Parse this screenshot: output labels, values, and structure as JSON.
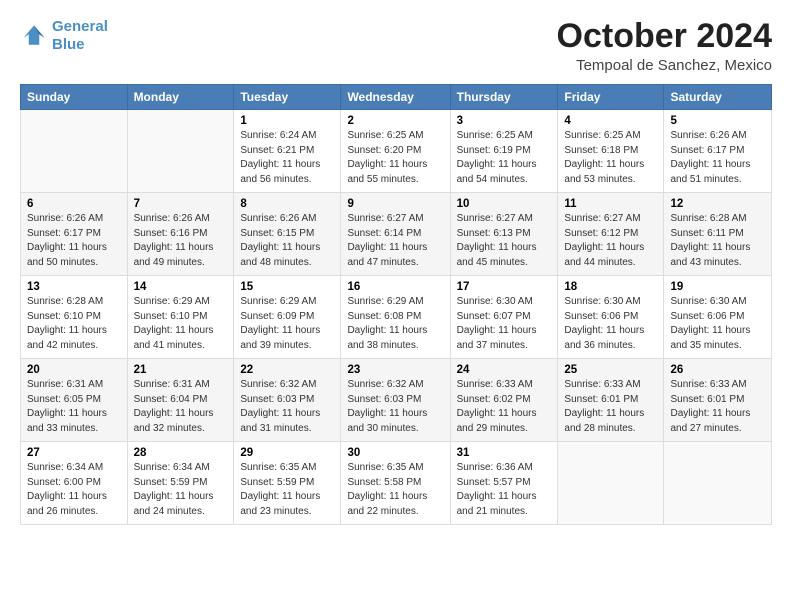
{
  "logo": {
    "line1": "General",
    "line2": "Blue"
  },
  "title": "October 2024",
  "subtitle": "Tempoal de Sanchez, Mexico",
  "headers": [
    "Sunday",
    "Monday",
    "Tuesday",
    "Wednesday",
    "Thursday",
    "Friday",
    "Saturday"
  ],
  "weeks": [
    [
      {
        "num": "",
        "detail": ""
      },
      {
        "num": "",
        "detail": ""
      },
      {
        "num": "1",
        "detail": "Sunrise: 6:24 AM\nSunset: 6:21 PM\nDaylight: 11 hours\nand 56 minutes."
      },
      {
        "num": "2",
        "detail": "Sunrise: 6:25 AM\nSunset: 6:20 PM\nDaylight: 11 hours\nand 55 minutes."
      },
      {
        "num": "3",
        "detail": "Sunrise: 6:25 AM\nSunset: 6:19 PM\nDaylight: 11 hours\nand 54 minutes."
      },
      {
        "num": "4",
        "detail": "Sunrise: 6:25 AM\nSunset: 6:18 PM\nDaylight: 11 hours\nand 53 minutes."
      },
      {
        "num": "5",
        "detail": "Sunrise: 6:26 AM\nSunset: 6:17 PM\nDaylight: 11 hours\nand 51 minutes."
      }
    ],
    [
      {
        "num": "6",
        "detail": "Sunrise: 6:26 AM\nSunset: 6:17 PM\nDaylight: 11 hours\nand 50 minutes."
      },
      {
        "num": "7",
        "detail": "Sunrise: 6:26 AM\nSunset: 6:16 PM\nDaylight: 11 hours\nand 49 minutes."
      },
      {
        "num": "8",
        "detail": "Sunrise: 6:26 AM\nSunset: 6:15 PM\nDaylight: 11 hours\nand 48 minutes."
      },
      {
        "num": "9",
        "detail": "Sunrise: 6:27 AM\nSunset: 6:14 PM\nDaylight: 11 hours\nand 47 minutes."
      },
      {
        "num": "10",
        "detail": "Sunrise: 6:27 AM\nSunset: 6:13 PM\nDaylight: 11 hours\nand 45 minutes."
      },
      {
        "num": "11",
        "detail": "Sunrise: 6:27 AM\nSunset: 6:12 PM\nDaylight: 11 hours\nand 44 minutes."
      },
      {
        "num": "12",
        "detail": "Sunrise: 6:28 AM\nSunset: 6:11 PM\nDaylight: 11 hours\nand 43 minutes."
      }
    ],
    [
      {
        "num": "13",
        "detail": "Sunrise: 6:28 AM\nSunset: 6:10 PM\nDaylight: 11 hours\nand 42 minutes."
      },
      {
        "num": "14",
        "detail": "Sunrise: 6:29 AM\nSunset: 6:10 PM\nDaylight: 11 hours\nand 41 minutes."
      },
      {
        "num": "15",
        "detail": "Sunrise: 6:29 AM\nSunset: 6:09 PM\nDaylight: 11 hours\nand 39 minutes."
      },
      {
        "num": "16",
        "detail": "Sunrise: 6:29 AM\nSunset: 6:08 PM\nDaylight: 11 hours\nand 38 minutes."
      },
      {
        "num": "17",
        "detail": "Sunrise: 6:30 AM\nSunset: 6:07 PM\nDaylight: 11 hours\nand 37 minutes."
      },
      {
        "num": "18",
        "detail": "Sunrise: 6:30 AM\nSunset: 6:06 PM\nDaylight: 11 hours\nand 36 minutes."
      },
      {
        "num": "19",
        "detail": "Sunrise: 6:30 AM\nSunset: 6:06 PM\nDaylight: 11 hours\nand 35 minutes."
      }
    ],
    [
      {
        "num": "20",
        "detail": "Sunrise: 6:31 AM\nSunset: 6:05 PM\nDaylight: 11 hours\nand 33 minutes."
      },
      {
        "num": "21",
        "detail": "Sunrise: 6:31 AM\nSunset: 6:04 PM\nDaylight: 11 hours\nand 32 minutes."
      },
      {
        "num": "22",
        "detail": "Sunrise: 6:32 AM\nSunset: 6:03 PM\nDaylight: 11 hours\nand 31 minutes."
      },
      {
        "num": "23",
        "detail": "Sunrise: 6:32 AM\nSunset: 6:03 PM\nDaylight: 11 hours\nand 30 minutes."
      },
      {
        "num": "24",
        "detail": "Sunrise: 6:33 AM\nSunset: 6:02 PM\nDaylight: 11 hours\nand 29 minutes."
      },
      {
        "num": "25",
        "detail": "Sunrise: 6:33 AM\nSunset: 6:01 PM\nDaylight: 11 hours\nand 28 minutes."
      },
      {
        "num": "26",
        "detail": "Sunrise: 6:33 AM\nSunset: 6:01 PM\nDaylight: 11 hours\nand 27 minutes."
      }
    ],
    [
      {
        "num": "27",
        "detail": "Sunrise: 6:34 AM\nSunset: 6:00 PM\nDaylight: 11 hours\nand 26 minutes."
      },
      {
        "num": "28",
        "detail": "Sunrise: 6:34 AM\nSunset: 5:59 PM\nDaylight: 11 hours\nand 24 minutes."
      },
      {
        "num": "29",
        "detail": "Sunrise: 6:35 AM\nSunset: 5:59 PM\nDaylight: 11 hours\nand 23 minutes."
      },
      {
        "num": "30",
        "detail": "Sunrise: 6:35 AM\nSunset: 5:58 PM\nDaylight: 11 hours\nand 22 minutes."
      },
      {
        "num": "31",
        "detail": "Sunrise: 6:36 AM\nSunset: 5:57 PM\nDaylight: 11 hours\nand 21 minutes."
      },
      {
        "num": "",
        "detail": ""
      },
      {
        "num": "",
        "detail": ""
      }
    ]
  ]
}
